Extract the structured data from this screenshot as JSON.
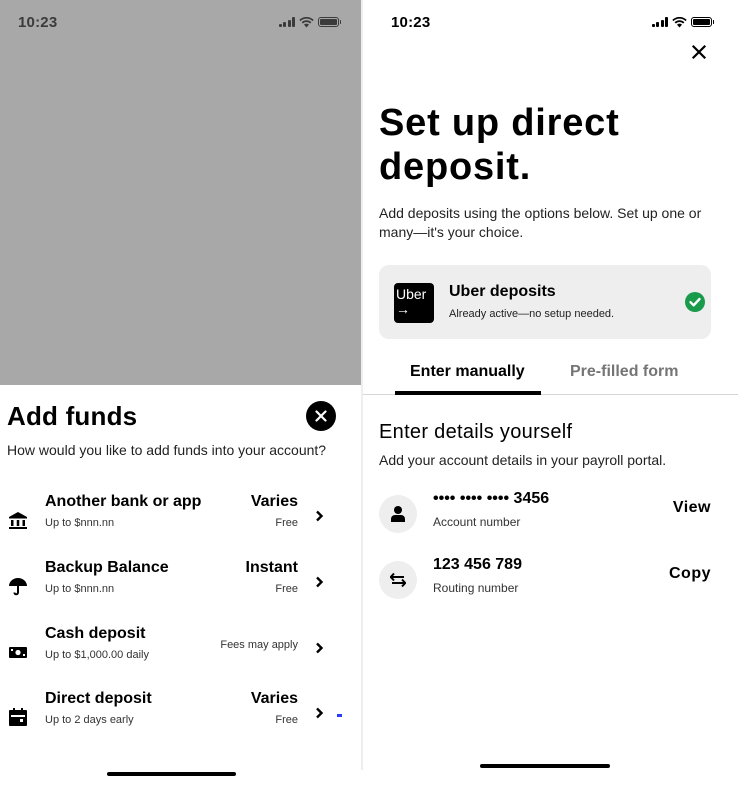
{
  "left": {
    "status": {
      "time": "10:23"
    },
    "sheet": {
      "title": "Add funds",
      "subtitle": "How would you like to add funds into your account?",
      "options": [
        {
          "icon": "bank-icon",
          "title": "Another bank or app",
          "subtitle": "Up to $nnn.nn",
          "speed": "Varies",
          "fee": "Free"
        },
        {
          "icon": "umbrella-icon",
          "title": "Backup Balance",
          "subtitle": "Up to $nnn.nn",
          "speed": "Instant",
          "fee": "Free"
        },
        {
          "icon": "cash-icon",
          "title": "Cash deposit",
          "subtitle": "Up to $1,000.00 daily",
          "speed": "",
          "fee": "Fees may apply"
        },
        {
          "icon": "calendar-icon",
          "title": "Direct deposit",
          "subtitle": "Up to 2 days early",
          "speed": "Varies",
          "fee": "Free"
        }
      ]
    }
  },
  "right": {
    "status": {
      "time": "10:23"
    },
    "title": "Set up direct deposit.",
    "description": "Add deposits using the options below. Set up one or many—it's your choice.",
    "uber_card": {
      "logo_text": "Uber",
      "logo_arrow": "→",
      "title": "Uber deposits",
      "subtitle": "Already active—no setup needed."
    },
    "tabs": [
      {
        "label": "Enter manually",
        "active": true
      },
      {
        "label": "Pre-filled form",
        "active": false
      }
    ],
    "section": {
      "title": "Enter details yourself",
      "subtitle": "Add your account details in your payroll portal."
    },
    "account": {
      "number": "•••• •••• •••• 3456",
      "number_label": "Account number",
      "number_action": "View",
      "routing": "123 456 789",
      "routing_label": "Routing number",
      "routing_action": "Copy"
    }
  },
  "colors": {
    "overlay": "#a8a8a8",
    "check_green": "#1a9b4b",
    "card_bg": "#eeeeee",
    "inactive_tab": "#757575",
    "marker_blue": "#2b3cff"
  }
}
